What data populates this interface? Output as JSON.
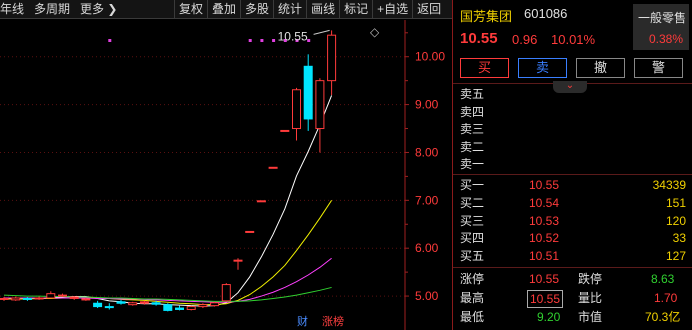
{
  "toolbar": {
    "period_partial": "年线",
    "multi_period": "多周期",
    "more": "更多",
    "more_chevron": "❯",
    "tools": [
      "复权",
      "叠加",
      "多股",
      "统计",
      "画线",
      "标记",
      "+自选",
      "返回"
    ]
  },
  "chart": {
    "price_axis_labels": [
      "10.00",
      "9.00",
      "8.00",
      "7.00",
      "6.00",
      "5.00"
    ],
    "high_marker": "10.55",
    "badge_finance": "财",
    "badge_limit_up": "涨榜",
    "diamond": "◇"
  },
  "chart_data": {
    "type": "candlestick",
    "candles": [
      {
        "open": 4.93,
        "close": 4.95,
        "high": 4.98,
        "low": 4.9
      },
      {
        "open": 4.92,
        "close": 4.96,
        "high": 4.99,
        "low": 4.9
      },
      {
        "open": 4.95,
        "close": 4.93,
        "high": 4.98,
        "low": 4.9
      },
      {
        "open": 4.95,
        "close": 4.96,
        "high": 4.99,
        "low": 4.92
      },
      {
        "open": 4.96,
        "close": 5.05,
        "high": 5.1,
        "low": 4.95
      },
      {
        "open": 5.02,
        "close": 5.02,
        "high": 5.05,
        "low": 4.98
      },
      {
        "open": 4.95,
        "close": 4.98,
        "high": 5.0,
        "low": 4.92
      },
      {
        "open": 4.92,
        "close": 4.94,
        "high": 4.96,
        "low": 4.9
      },
      {
        "open": 4.85,
        "close": 4.78,
        "high": 4.9,
        "low": 4.75
      },
      {
        "open": 4.78,
        "close": 4.76,
        "high": 4.85,
        "low": 4.72
      },
      {
        "open": 4.88,
        "close": 4.85,
        "high": 4.92,
        "low": 4.82
      },
      {
        "open": 4.82,
        "close": 4.86,
        "high": 4.88,
        "low": 4.8
      },
      {
        "open": 4.85,
        "close": 4.88,
        "high": 4.9,
        "low": 4.82
      },
      {
        "open": 4.86,
        "close": 4.83,
        "high": 4.9,
        "low": 4.8
      },
      {
        "open": 4.82,
        "close": 4.7,
        "high": 4.85,
        "low": 4.68
      },
      {
        "open": 4.75,
        "close": 4.72,
        "high": 4.8,
        "low": 4.7
      },
      {
        "open": 4.72,
        "close": 4.78,
        "high": 4.8,
        "low": 4.7
      },
      {
        "open": 4.78,
        "close": 4.82,
        "high": 4.85,
        "low": 4.75
      },
      {
        "open": 4.8,
        "close": 4.86,
        "high": 4.88,
        "low": 4.78
      },
      {
        "open": 4.9,
        "close": 5.24,
        "high": 5.27,
        "low": 4.88
      },
      {
        "open": 5.75,
        "close": 5.75,
        "high": 5.79,
        "low": 5.55
      },
      {
        "open": 6.35,
        "close": 6.35,
        "high": 6.35,
        "low": 6.35
      },
      {
        "open": 6.99,
        "close": 6.99,
        "high": 6.99,
        "low": 6.99
      },
      {
        "open": 7.69,
        "close": 7.69,
        "high": 7.69,
        "low": 7.69
      },
      {
        "open": 8.46,
        "close": 8.46,
        "high": 8.46,
        "low": 8.46
      },
      {
        "open": 8.5,
        "close": 9.31,
        "high": 9.35,
        "low": 8.25
      },
      {
        "open": 9.8,
        "close": 8.7,
        "high": 10.05,
        "low": 8.45
      },
      {
        "open": 8.5,
        "close": 9.5,
        "high": 9.55,
        "low": 8.0
      },
      {
        "open": 9.5,
        "close": 10.45,
        "high": 10.55,
        "low": 9.2
      }
    ],
    "ma": [
      {
        "name": "MA5",
        "color": "#ffffff",
        "values": [
          4.94,
          4.95,
          4.95,
          4.95,
          4.97,
          4.98,
          4.99,
          4.99,
          4.95,
          4.9,
          4.88,
          4.85,
          4.84,
          4.84,
          4.82,
          4.81,
          4.8,
          4.79,
          4.8,
          4.86,
          5.07,
          5.4,
          5.82,
          6.29,
          6.82,
          7.51,
          8.02,
          8.58,
          9.19
        ]
      },
      {
        "name": "MA10",
        "color": "#f0f000",
        "values": [
          4.94,
          4.94,
          4.94,
          4.95,
          4.95,
          4.96,
          4.96,
          4.97,
          4.96,
          4.95,
          4.93,
          4.92,
          4.91,
          4.89,
          4.87,
          4.85,
          4.84,
          4.82,
          4.82,
          4.84,
          4.91,
          5.03,
          5.2,
          5.4,
          5.64,
          5.95,
          6.28,
          6.63,
          7.0,
          7.8
        ]
      },
      {
        "name": "MA20",
        "color": "#ff40ff",
        "values": [
          4.96,
          4.96,
          4.96,
          4.96,
          4.96,
          4.96,
          4.96,
          4.96,
          4.95,
          4.95,
          4.94,
          4.94,
          4.93,
          4.92,
          4.91,
          4.9,
          4.89,
          4.88,
          4.87,
          4.87,
          4.89,
          4.93,
          5.0,
          5.08,
          5.18,
          5.3,
          5.44,
          5.6,
          5.79,
          6.25
        ]
      },
      {
        "name": "MA60",
        "color": "#30d030",
        "values": [
          5.02,
          5.01,
          5.0,
          5.0,
          4.99,
          4.99,
          4.98,
          4.98,
          4.97,
          4.96,
          4.96,
          4.95,
          4.94,
          4.94,
          4.93,
          4.92,
          4.91,
          4.9,
          4.89,
          4.89,
          4.89,
          4.9,
          4.92,
          4.95,
          4.98,
          5.02,
          5.07,
          5.12,
          5.18,
          5.28
        ]
      }
    ],
    "ylim": [
      4.5,
      10.6
    ]
  },
  "stock": {
    "name": "国芳集团",
    "code": "601086",
    "price": "10.55",
    "change": "0.96",
    "change_pct": "10.01%",
    "odd_lot_label": "一般零售",
    "odd_lot_value": "0.38%"
  },
  "buttons": {
    "buy": "买",
    "sell": "卖",
    "cancel": "撤",
    "warn": "警"
  },
  "collapse_icon": "⌄",
  "asks": [
    {
      "label": "卖五",
      "price": "",
      "vol": ""
    },
    {
      "label": "卖四",
      "price": "",
      "vol": ""
    },
    {
      "label": "卖三",
      "price": "",
      "vol": ""
    },
    {
      "label": "卖二",
      "price": "",
      "vol": ""
    },
    {
      "label": "卖一",
      "price": "",
      "vol": ""
    }
  ],
  "bids": [
    {
      "label": "买一",
      "price": "10.55",
      "vol": "34339"
    },
    {
      "label": "买二",
      "price": "10.54",
      "vol": "151"
    },
    {
      "label": "买三",
      "price": "10.53",
      "vol": "120"
    },
    {
      "label": "买四",
      "price": "10.52",
      "vol": "33"
    },
    {
      "label": "买五",
      "price": "10.51",
      "vol": "127"
    }
  ],
  "stats": {
    "limit_up_label": "涨停",
    "limit_up": "10.55",
    "limit_down_label": "跌停",
    "limit_down": "8.63",
    "high_label": "最高",
    "high": "10.55",
    "vol_ratio_label": "量比",
    "vol_ratio": "1.70",
    "low_label": "最低",
    "low": "9.20",
    "mkt_cap_label": "市值",
    "mkt_cap": "70.3亿"
  },
  "colors": {
    "up": "#ff3b3b",
    "down": "#00e5ff",
    "yellow": "#f0d000",
    "green": "#30d030"
  }
}
